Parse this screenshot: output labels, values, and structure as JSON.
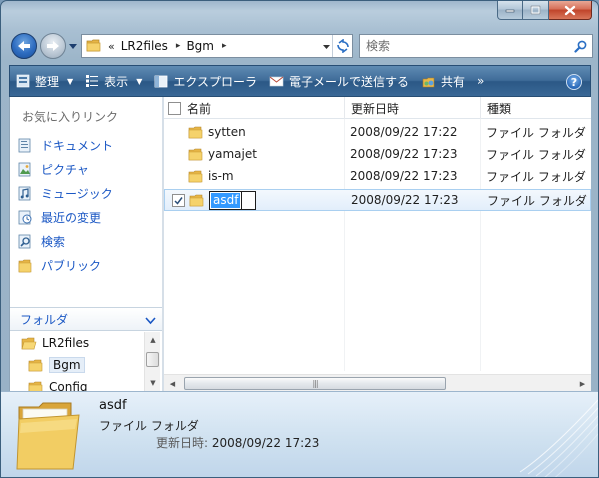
{
  "window": {
    "caption_buttons": {
      "minimize": "minimize-icon",
      "maximize": "maximize-icon",
      "close": "close-icon"
    }
  },
  "address": {
    "chevrons": "«",
    "crumbs": [
      "LR2files",
      "Bgm"
    ],
    "separator": "▸"
  },
  "search": {
    "placeholder": "検索"
  },
  "toolbar": {
    "organize": "整理",
    "views": "表示",
    "explore": "エクスプローラ",
    "email": "電子メールで送信する",
    "share": "共有",
    "more": "»",
    "help": "?"
  },
  "nav": {
    "favorites_header": "お気に入りリンク",
    "favorites": [
      {
        "label": "ドキュメント",
        "icon": "documents-icon"
      },
      {
        "label": "ピクチャ",
        "icon": "pictures-icon"
      },
      {
        "label": "ミュージック",
        "icon": "music-icon"
      },
      {
        "label": "最近の変更",
        "icon": "recent-changes-icon"
      },
      {
        "label": "検索",
        "icon": "searches-icon"
      },
      {
        "label": "パブリック",
        "icon": "public-folder-icon"
      }
    ],
    "folders_header": "フォルダ",
    "tree": [
      {
        "label": "LR2files"
      },
      {
        "label": "Bgm"
      },
      {
        "label": "Config"
      }
    ]
  },
  "files": {
    "columns": {
      "name": "名前",
      "date": "更新日時",
      "type": "種類"
    },
    "rows": [
      {
        "name": "sytten",
        "date": "2008/09/22 17:22",
        "type": "ファイル フォルダ"
      },
      {
        "name": "yamajet",
        "date": "2008/09/22 17:23",
        "type": "ファイル フォルダ"
      },
      {
        "name": "is-m",
        "date": "2008/09/22 17:23",
        "type": "ファイル フォルダ"
      },
      {
        "name": "asdf",
        "date": "2008/09/22 17:23",
        "type": "ファイル フォルダ",
        "selected": true,
        "renaming": true
      }
    ],
    "scroll_grip": "|||"
  },
  "details": {
    "name": "asdf",
    "type": "ファイル フォルダ",
    "modified_label": "更新日時:",
    "modified_value": "2008/09/22 17:23"
  },
  "colors": {
    "toolbar": "#3f6c99",
    "link": "#1a57c4",
    "selection": "#a9cff0",
    "rename_highlight": "#3399ff"
  }
}
